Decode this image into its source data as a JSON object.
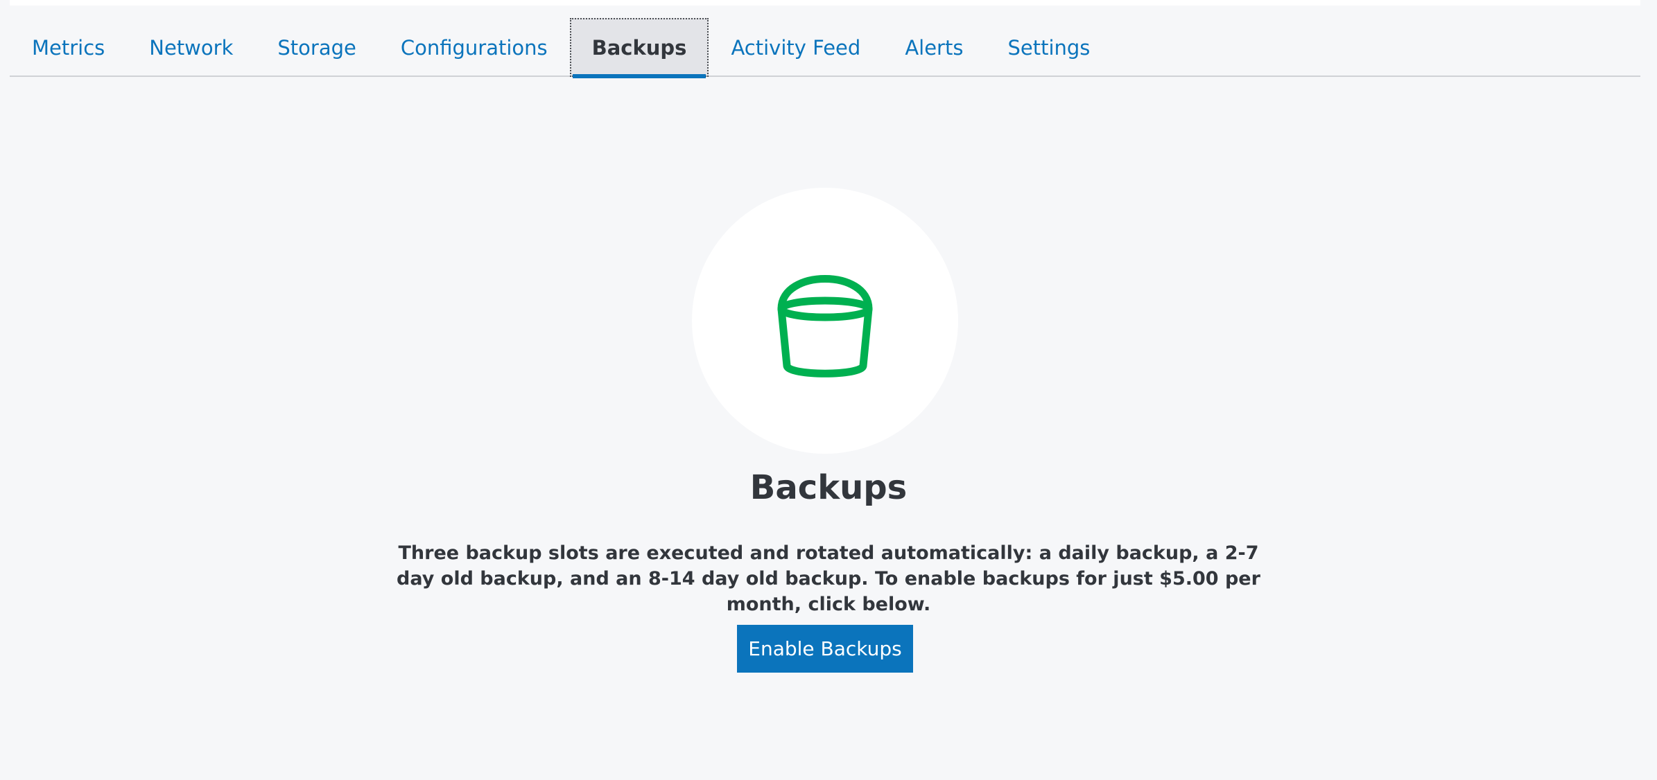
{
  "tabs": [
    {
      "label": "Metrics",
      "active": false
    },
    {
      "label": "Network",
      "active": false
    },
    {
      "label": "Storage",
      "active": false
    },
    {
      "label": "Configurations",
      "active": false
    },
    {
      "label": "Backups",
      "active": true
    },
    {
      "label": "Activity Feed",
      "active": false
    },
    {
      "label": "Alerts",
      "active": false
    },
    {
      "label": "Settings",
      "active": false
    }
  ],
  "hero": {
    "icon": "bucket-icon",
    "icon_color": "#00b050",
    "title": "Backups",
    "description": "Three backup slots are executed and rotated automatically: a daily backup, a 2-7 day old backup, and an 8-14 day old backup. To enable backups for just $5.00 per month, click below.",
    "button_label": "Enable Backups"
  },
  "colors": {
    "accent": "#0b74bc",
    "background": "#f6f7f9",
    "text": "#32363c"
  }
}
